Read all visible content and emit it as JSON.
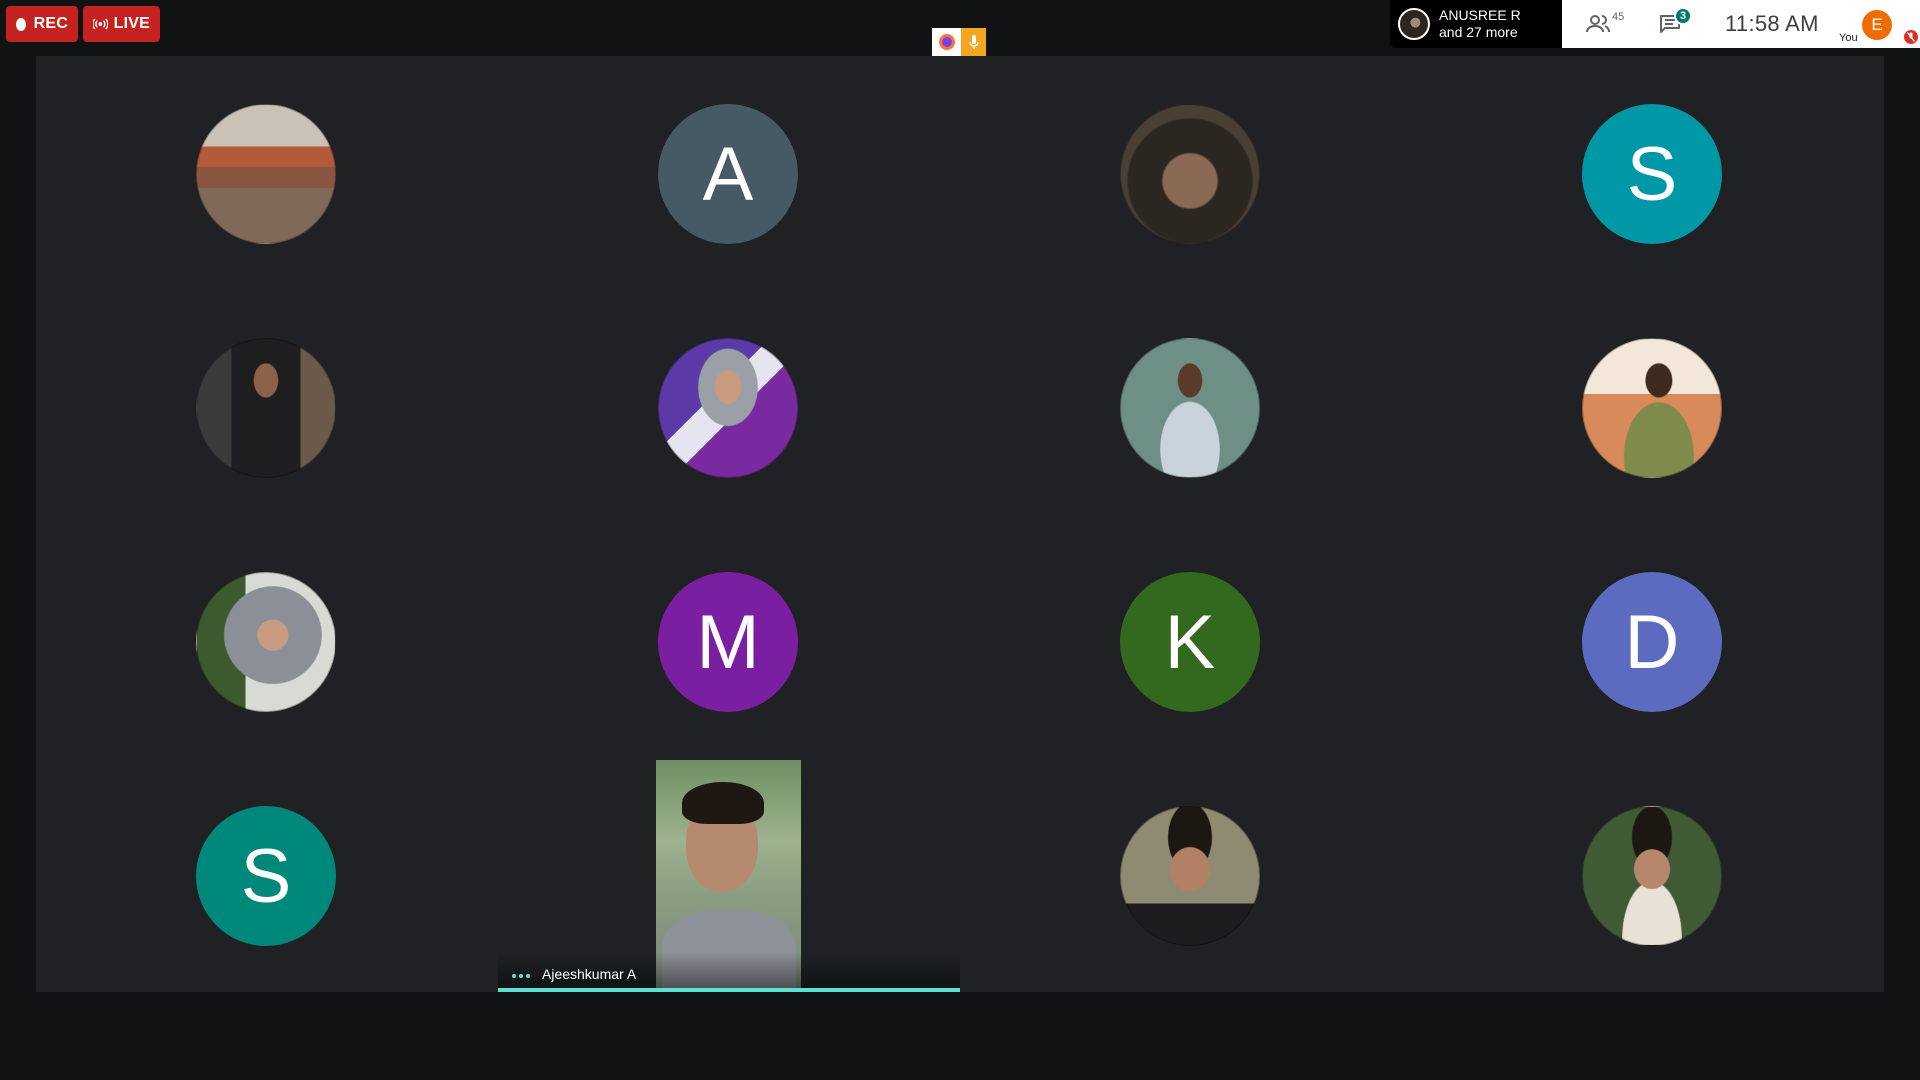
{
  "topbar": {
    "rec_label": "REC",
    "live_label": "LIVE",
    "active_speaker": {
      "name": "ANUSREE R",
      "more": "and 27 more"
    },
    "participants_count": "45",
    "chat_unread": "3",
    "time": "11:58 AM",
    "self": {
      "initial": "E",
      "label": "You"
    }
  },
  "colors": {
    "rec_red": "#c5221f",
    "speaking_teal": "#5ce1d5",
    "stage_bg": "#202124"
  },
  "tiles": [
    {
      "type": "photo",
      "icon": "classroom-photo"
    },
    {
      "type": "initial",
      "initial": "A",
      "color": "#455a64"
    },
    {
      "type": "photo",
      "icon": "portrait-photo"
    },
    {
      "type": "initial",
      "initial": "S",
      "color": "#0097a7"
    },
    {
      "type": "photo",
      "icon": "portrait-photo"
    },
    {
      "type": "photo",
      "icon": "portrait-photo"
    },
    {
      "type": "photo",
      "icon": "portrait-photo"
    },
    {
      "type": "photo",
      "icon": "portrait-photo"
    },
    {
      "type": "photo",
      "icon": "portrait-photo"
    },
    {
      "type": "initial",
      "initial": "M",
      "color": "#7b1fa2"
    },
    {
      "type": "initial",
      "initial": "K",
      "color": "#33691e"
    },
    {
      "type": "initial",
      "initial": "D",
      "color": "#5c6bc0"
    },
    {
      "type": "initial",
      "initial": "S",
      "color": "#00897b"
    },
    {
      "type": "video",
      "name": "Ajeeshkumar A"
    },
    {
      "type": "photo",
      "icon": "portrait-photo"
    },
    {
      "type": "photo",
      "icon": "portrait-photo"
    }
  ]
}
